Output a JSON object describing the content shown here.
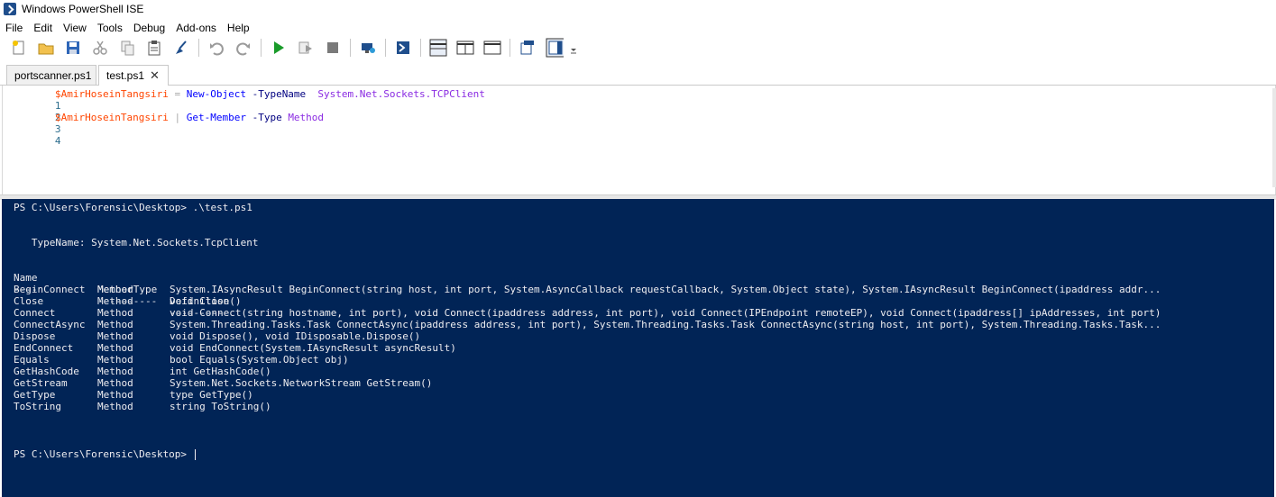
{
  "window": {
    "title": "Windows PowerShell ISE"
  },
  "menu": [
    "File",
    "Edit",
    "View",
    "Tools",
    "Debug",
    "Add-ons",
    "Help"
  ],
  "toolbar": {
    "buttons": [
      "new-script",
      "open",
      "save",
      "cut",
      "copy",
      "paste",
      "clear-console",
      "undo",
      "redo",
      "run-script",
      "run-selection",
      "stop",
      "new-remote-tab",
      "start-powershell",
      "show-script-pane-top",
      "show-script-pane-right",
      "show-script-pane-maximized",
      "show-command-window",
      "show-command-addon",
      "toolbar-overflow"
    ]
  },
  "tabs": [
    {
      "label": "portscanner.ps1",
      "active": false
    },
    {
      "label": "test.ps1",
      "active": true,
      "close": "✕"
    }
  ],
  "editor": {
    "lines": [
      {
        "num": "1",
        "var": "$AmirHoseinTangsiri",
        "op": " = ",
        "cmd": "New-Object",
        "param": " -TypeName ",
        "arg": " System.Net.Sockets.TCPClient"
      },
      {
        "num": "2"
      },
      {
        "num": "3",
        "var": "$AmirHoseinTangsiri",
        "op": " | ",
        "cmd": "Get-Member",
        "param": " -Type ",
        "arg": "Method"
      },
      {
        "num": "4"
      }
    ]
  },
  "console": {
    "prompt_cmd": "PS C:\\Users\\Forensic\\Desktop> .\\test.ps1",
    "typename": "   TypeName: System.Net.Sockets.TcpClient",
    "headers": {
      "name": "Name",
      "type": "MemberType",
      "def": "Definition"
    },
    "underline": {
      "name": "----",
      "type": "----------",
      "def": "----------"
    },
    "rows": [
      {
        "name": "BeginConnect",
        "type": "Method",
        "def": "System.IAsyncResult BeginConnect(string host, int port, System.AsyncCallback requestCallback, System.Object state), System.IAsyncResult BeginConnect(ipaddress addr..."
      },
      {
        "name": "Close",
        "type": "Method",
        "def": "void Close()"
      },
      {
        "name": "Connect",
        "type": "Method",
        "def": "void Connect(string hostname, int port), void Connect(ipaddress address, int port), void Connect(IPEndpoint remoteEP), void Connect(ipaddress[] ipAddresses, int port)"
      },
      {
        "name": "ConnectAsync",
        "type": "Method",
        "def": "System.Threading.Tasks.Task ConnectAsync(ipaddress address, int port), System.Threading.Tasks.Task ConnectAsync(string host, int port), System.Threading.Tasks.Task..."
      },
      {
        "name": "Dispose",
        "type": "Method",
        "def": "void Dispose(), void IDisposable.Dispose()"
      },
      {
        "name": "EndConnect",
        "type": "Method",
        "def": "void EndConnect(System.IAsyncResult asyncResult)"
      },
      {
        "name": "Equals",
        "type": "Method",
        "def": "bool Equals(System.Object obj)"
      },
      {
        "name": "GetHashCode",
        "type": "Method",
        "def": "int GetHashCode()"
      },
      {
        "name": "GetStream",
        "type": "Method",
        "def": "System.Net.Sockets.NetworkStream GetStream()"
      },
      {
        "name": "GetType",
        "type": "Method",
        "def": "type GetType()"
      },
      {
        "name": "ToString",
        "type": "Method",
        "def": "string ToString()"
      }
    ],
    "final_prompt": "PS C:\\Users\\Forensic\\Desktop> "
  },
  "colors": {
    "console_bg": "#012456",
    "console_fg": "#eeedf0",
    "variable": "#ff4500",
    "cmdlet": "#0000ff",
    "parameter": "#000080",
    "argument": "#8a2be2"
  }
}
